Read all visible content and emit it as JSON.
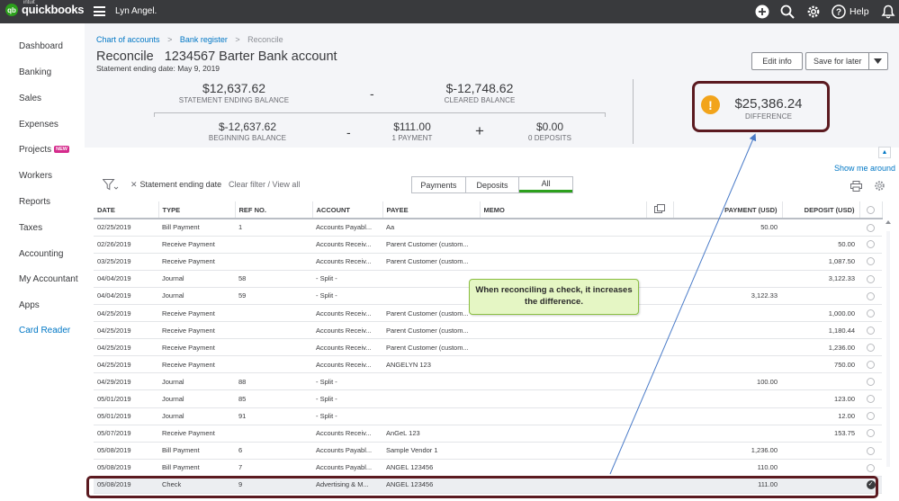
{
  "topbar": {
    "brand_small": "intuit",
    "brand": "quickbooks",
    "logo_mark": "qb",
    "company": "Lyn Angel.",
    "help_label": "Help",
    "icons": [
      "plus-circle-icon",
      "search-icon",
      "gear-icon",
      "help-icon",
      "bell-icon"
    ]
  },
  "sidebar": {
    "items": [
      {
        "label": "Dashboard"
      },
      {
        "label": "Banking"
      },
      {
        "label": "Sales"
      },
      {
        "label": "Expenses"
      },
      {
        "label": "Projects",
        "badge": "NEW"
      },
      {
        "label": "Workers"
      },
      {
        "label": "Reports"
      },
      {
        "label": "Taxes"
      },
      {
        "label": "Accounting"
      },
      {
        "label": "My Accountant"
      },
      {
        "label": "Apps"
      },
      {
        "label": "Card Reader"
      }
    ]
  },
  "header": {
    "breadcrumb": [
      "Chart of accounts",
      "Bank register",
      "Reconcile"
    ],
    "breadcrumb_sep": ">",
    "title": "Reconcile",
    "account": "1234567 Barter Bank account",
    "statement_date": "Statement ending date: May 9, 2019",
    "edit_info": "Edit info",
    "save_for_later": "Save for later"
  },
  "summary": {
    "statement_ending_balance": {
      "value": "$12,637.62",
      "label": "STATEMENT ENDING BALANCE"
    },
    "cleared_balance": {
      "value": "$-12,748.62",
      "label": "CLEARED BALANCE"
    },
    "beginning_balance": {
      "value": "$-12,637.62",
      "label": "BEGINNING BALANCE"
    },
    "payments": {
      "value": "$111.00",
      "label": "1 PAYMENT"
    },
    "deposits": {
      "value": "$0.00",
      "label": "0 DEPOSITS"
    },
    "difference": {
      "value": "$25,386.24",
      "label": "DIFFERENCE"
    },
    "op_minus": "-",
    "op_plus": "+"
  },
  "toolbar": {
    "filter_label": "Statement ending date",
    "clear_filter": "Clear filter / View all",
    "show_me_around": "Show me around",
    "tabs": [
      "Payments",
      "Deposits",
      "All"
    ],
    "active_tab": "All"
  },
  "table": {
    "columns": [
      "DATE",
      "TYPE",
      "REF NO.",
      "ACCOUNT",
      "PAYEE",
      "MEMO",
      "",
      "PAYMENT (USD)",
      "DEPOSIT (USD)",
      ""
    ],
    "rows": [
      [
        "02/25/2019",
        "Bill Payment",
        "1",
        "Accounts Payabl...",
        "Aa",
        "",
        "50.00",
        "",
        false
      ],
      [
        "02/26/2019",
        "Receive Payment",
        "",
        "Accounts Receiv...",
        "Parent Customer (custom...",
        "",
        "",
        "50.00",
        false
      ],
      [
        "03/25/2019",
        "Receive Payment",
        "",
        "Accounts Receiv...",
        "Parent Customer (custom...",
        "",
        "",
        "1,087.50",
        false
      ],
      [
        "04/04/2019",
        "Journal",
        "58",
        "- Split -",
        "",
        "",
        "",
        "3,122.33",
        false
      ],
      [
        "04/04/2019",
        "Journal",
        "59",
        "- Split -",
        "",
        "",
        "3,122.33",
        "",
        false
      ],
      [
        "04/25/2019",
        "Receive Payment",
        "",
        "Accounts Receiv...",
        "Parent Customer (custom...",
        "",
        "",
        "1,000.00",
        false
      ],
      [
        "04/25/2019",
        "Receive Payment",
        "",
        "Accounts Receiv...",
        "Parent Customer (custom...",
        "",
        "",
        "1,180.44",
        false
      ],
      [
        "04/25/2019",
        "Receive Payment",
        "",
        "Accounts Receiv...",
        "Parent Customer (custom...",
        "",
        "",
        "1,236.00",
        false
      ],
      [
        "04/25/2019",
        "Receive Payment",
        "",
        "Accounts Receiv...",
        "ANGELYN 123",
        "",
        "",
        "750.00",
        false
      ],
      [
        "04/29/2019",
        "Journal",
        "88",
        "- Split -",
        "",
        "",
        "100.00",
        "",
        false
      ],
      [
        "05/01/2019",
        "Journal",
        "85",
        "- Split -",
        "",
        "",
        "",
        "123.00",
        false
      ],
      [
        "05/01/2019",
        "Journal",
        "91",
        "- Split -",
        "",
        "",
        "",
        "12.00",
        false
      ],
      [
        "05/07/2019",
        "Receive Payment",
        "",
        "Accounts Receiv...",
        "AnGeL 123",
        "",
        "",
        "153.75",
        false
      ],
      [
        "05/08/2019",
        "Bill Payment",
        "6",
        "Accounts Payabl...",
        "Sample Vendor 1",
        "",
        "1,236.00",
        "",
        false
      ],
      [
        "05/08/2019",
        "Bill Payment",
        "7",
        "Accounts Payabl...",
        "ANGEL 123456",
        "",
        "110.00",
        "",
        false
      ],
      [
        "05/08/2019",
        "Check",
        "9",
        "Advertising & M...",
        "ANGEL 123456",
        "",
        "111.00",
        "",
        true
      ]
    ]
  },
  "callout": {
    "text": "When reconciling a check, it increases the difference."
  },
  "colors": {
    "topbar": "#393a3d",
    "brand_green": "#2ca01c",
    "link": "#0077c5",
    "annotation": "#5b1a20",
    "warning": "#f2a41b",
    "callout_bg": "#e5f6c4"
  }
}
